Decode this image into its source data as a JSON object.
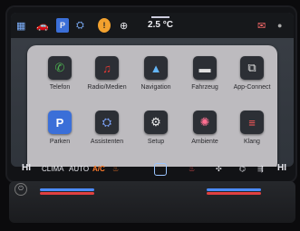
{
  "topbar": {
    "temperature": "2.5 °C",
    "icons": [
      "menu-grid-icon",
      "car-icon",
      "parking-icon",
      "assistant-icon",
      "warning-icon",
      "plus-circle-icon",
      "message-icon",
      "settings-dot-icon"
    ]
  },
  "apps": [
    {
      "label": "Telefon",
      "icon": "phone-icon",
      "glyph": "✆",
      "color": "#4caf50"
    },
    {
      "label": "Radio/Medien",
      "icon": "music-icon",
      "glyph": "♫",
      "color": "#e53935"
    },
    {
      "label": "Navigation",
      "icon": "navigation-arrow-icon",
      "glyph": "▲",
      "color": "#64b5f6"
    },
    {
      "label": "Fahrzeug",
      "icon": "car-icon",
      "glyph": "🚘",
      "color": "#e0e0e0"
    },
    {
      "label": "App-Connect",
      "icon": "app-connect-icon",
      "glyph": "⧉",
      "color": "#e0e0e0"
    },
    {
      "label": "Parken",
      "icon": "parking-icon",
      "glyph": "P",
      "color": "#5c8cff"
    },
    {
      "label": "Assistenten",
      "icon": "assistant-icon",
      "glyph": "⛭",
      "color": "#7ea6ff"
    },
    {
      "label": "Setup",
      "icon": "gear-icon",
      "glyph": "⚙",
      "color": "#f0f0f0"
    },
    {
      "label": "Ambiente",
      "icon": "ambient-icon",
      "glyph": "✺",
      "color": "#ff6f91"
    },
    {
      "label": "Klang",
      "icon": "equalizer-icon",
      "glyph": "≡",
      "color": "#ff5a5a"
    }
  ],
  "page_indicator": "• • •",
  "climate": {
    "hi_left": "HI",
    "clima": "CLIMA",
    "auto": "AUTO",
    "ac": "A/C",
    "hi_right": "HI"
  },
  "console": {
    "power": "⏻"
  }
}
